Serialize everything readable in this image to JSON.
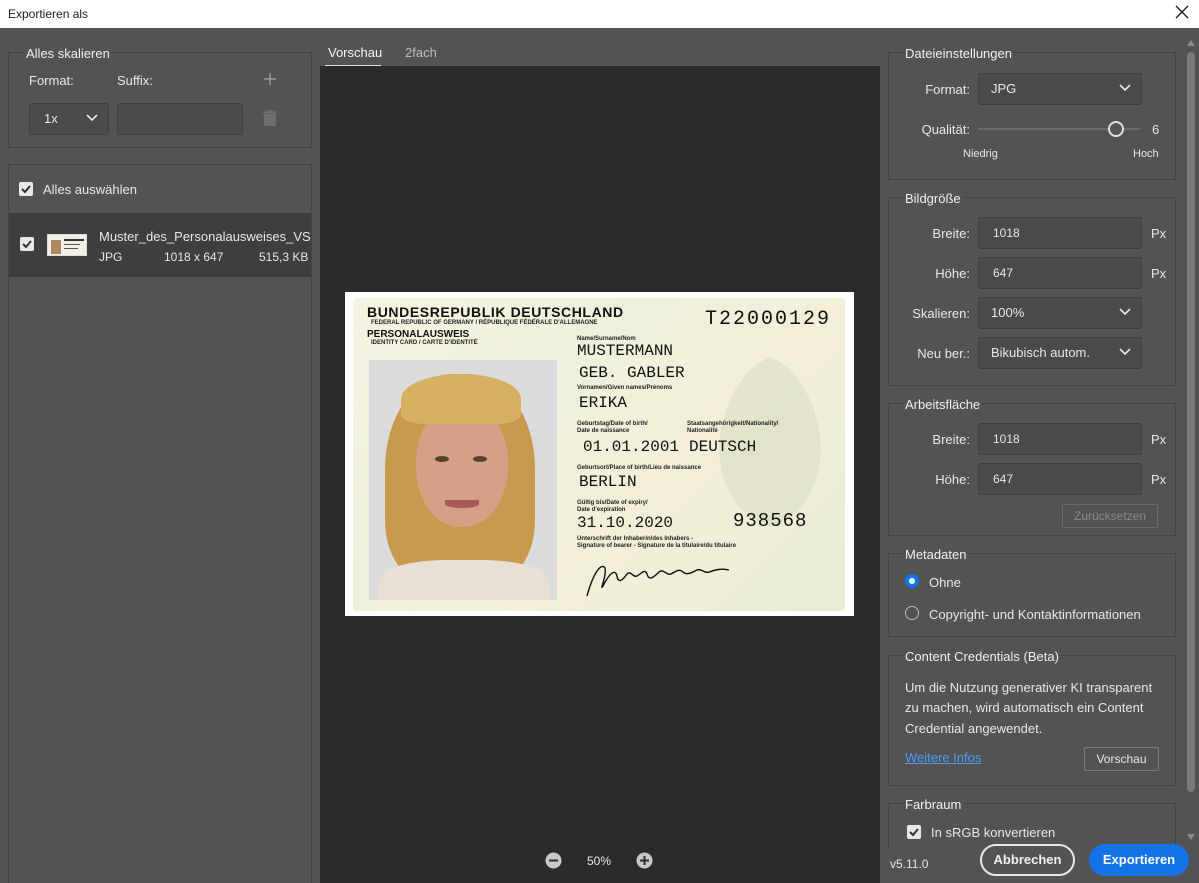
{
  "window": {
    "title": "Exportieren als"
  },
  "scale_panel": {
    "title": "Alles skalieren",
    "format_label": "Format:",
    "suffix_label": "Suffix:",
    "scale_value": "1x",
    "suffix_value": ""
  },
  "assets": {
    "select_all_label": "Alles auswählen",
    "items": [
      {
        "name": "Muster_des_Personalausweises_VS",
        "format": "JPG",
        "dimensions": "1018 x 647",
        "size": "515,3 KB"
      }
    ]
  },
  "preview": {
    "tabs": [
      "Vorschau",
      "2fach"
    ],
    "active_tab": "Vorschau",
    "zoom": "50%"
  },
  "id_card": {
    "country": "BUNDESREPUBLIK DEUTSCHLAND",
    "country_sub": "FEDERAL REPUBLIC OF GERMANY / RÉPUBLIQUE FÉDÉRALE D'ALLEMAGNE",
    "doc_type": "PERSONALAUSWEIS",
    "doc_type_sub": "IDENTITY CARD / CARTE D'IDENTITÉ",
    "doc_number": "T22000129",
    "name_label": "Name/Surname/Nom",
    "surname": "MUSTERMANN",
    "birth_name": "GEB. GABLER",
    "given_label": "Vornamen/Given names/Prénoms",
    "given_names": "ERIKA",
    "dob_label_1": "Geburtstag/Date of birth/",
    "dob_label_2": "Date de naissance",
    "dob": "01.01.2001",
    "nat_label_1": "Staatsangehörigkeit/Nationality/",
    "nat_label_2": "Nationalité",
    "nationality": "DEUTSCH",
    "pob_label": "Geburtsort/Place of birth/Lieu de naissance",
    "pob": "BERLIN",
    "exp_label_1": "Gültig bis/Date of expiry/",
    "exp_label_2": "Date d'expiration",
    "expiry": "31.10.2020",
    "can": "938568",
    "sig_label_1": "Unterschrift der Inhaberin/des Inhabers -",
    "sig_label_2": "Signature of bearer - Signature de la titulaire/du titulaire",
    "signature": "Mustermann"
  },
  "file_settings": {
    "title": "Dateieinstellungen",
    "format_label": "Format:",
    "format_value": "JPG",
    "quality_label": "Qualität:",
    "quality_value": "6",
    "quality_fraction": 0.85,
    "low_label": "Niedrig",
    "high_label": "Hoch"
  },
  "image_size": {
    "title": "Bildgröße",
    "width_label": "Breite:",
    "width_value": "1018",
    "height_label": "Höhe:",
    "height_value": "647",
    "unit": "Px",
    "scale_label": "Skalieren:",
    "scale_value": "100%",
    "resample_label": "Neu ber.:",
    "resample_value": "Bikubisch autom."
  },
  "canvas": {
    "title": "Arbeitsfläche",
    "width_label": "Breite:",
    "width_value": "1018",
    "height_label": "Höhe:",
    "height_value": "647",
    "unit": "Px",
    "reset_label": "Zurücksetzen"
  },
  "metadata": {
    "title": "Metadaten",
    "option_none": "Ohne",
    "option_copyright": "Copyright- und Kontaktinformationen",
    "selected": "Ohne"
  },
  "content_credentials": {
    "title": "Content Credentials (Beta)",
    "text_1": "Um die Nutzung generativer KI transparent",
    "text_2": "zu machen, wird automatisch ein Content",
    "text_3": "Credential angewendet.",
    "link": "Weitere Infos",
    "preview_button": "Vorschau"
  },
  "color_space": {
    "title": "Farbraum",
    "convert_label": "In sRGB konvertieren"
  },
  "footer": {
    "version": "v5.11.0",
    "cancel_label": "Abbrechen",
    "export_label": "Exportieren"
  },
  "colors": {
    "accent": "#1473e6",
    "panel_bg": "#535353",
    "preview_bg": "#2b2b2b"
  }
}
